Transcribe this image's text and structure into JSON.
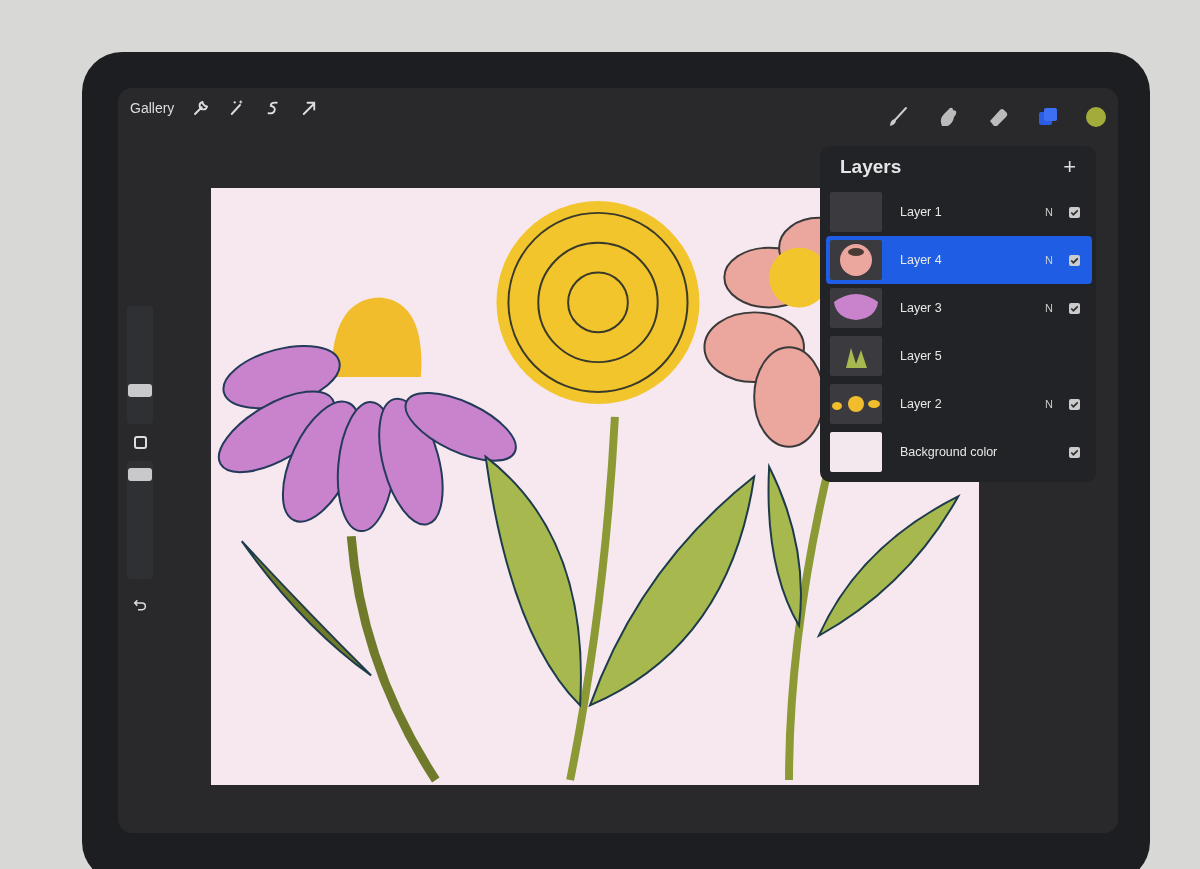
{
  "toolbar": {
    "gallery": "Gallery",
    "tools": [
      {
        "kind": "wrench"
      },
      {
        "kind": "wand"
      },
      {
        "kind": "select"
      },
      {
        "kind": "move"
      }
    ],
    "right_tools": [
      {
        "kind": "brush"
      },
      {
        "kind": "smudge"
      },
      {
        "kind": "eraser"
      },
      {
        "kind": "layers"
      }
    ],
    "color": "#a3ab3a"
  },
  "sidebar": {
    "size": {
      "level": 0.3
    },
    "opacity": {
      "level": 0.9
    }
  },
  "layers": {
    "title": "Layers",
    "add": "+",
    "items": [
      {
        "name": "Layer 1",
        "kind": "empty",
        "selected": false,
        "blend": "N",
        "visible": true
      },
      {
        "name": "Layer 4",
        "kind": "pink-flower",
        "selected": true,
        "blend": "N",
        "visible": true
      },
      {
        "name": "Layer 3",
        "kind": "purple-flower",
        "selected": false,
        "blend": "N",
        "visible": true
      },
      {
        "name": "Layer 5",
        "kind": "leaves",
        "selected": false
      },
      {
        "name": "Layer 2",
        "kind": "yellow-dots",
        "selected": false,
        "blend": "N",
        "visible": true
      },
      {
        "name": "Background color",
        "kind": "background",
        "selected": false,
        "visible": true
      }
    ]
  }
}
